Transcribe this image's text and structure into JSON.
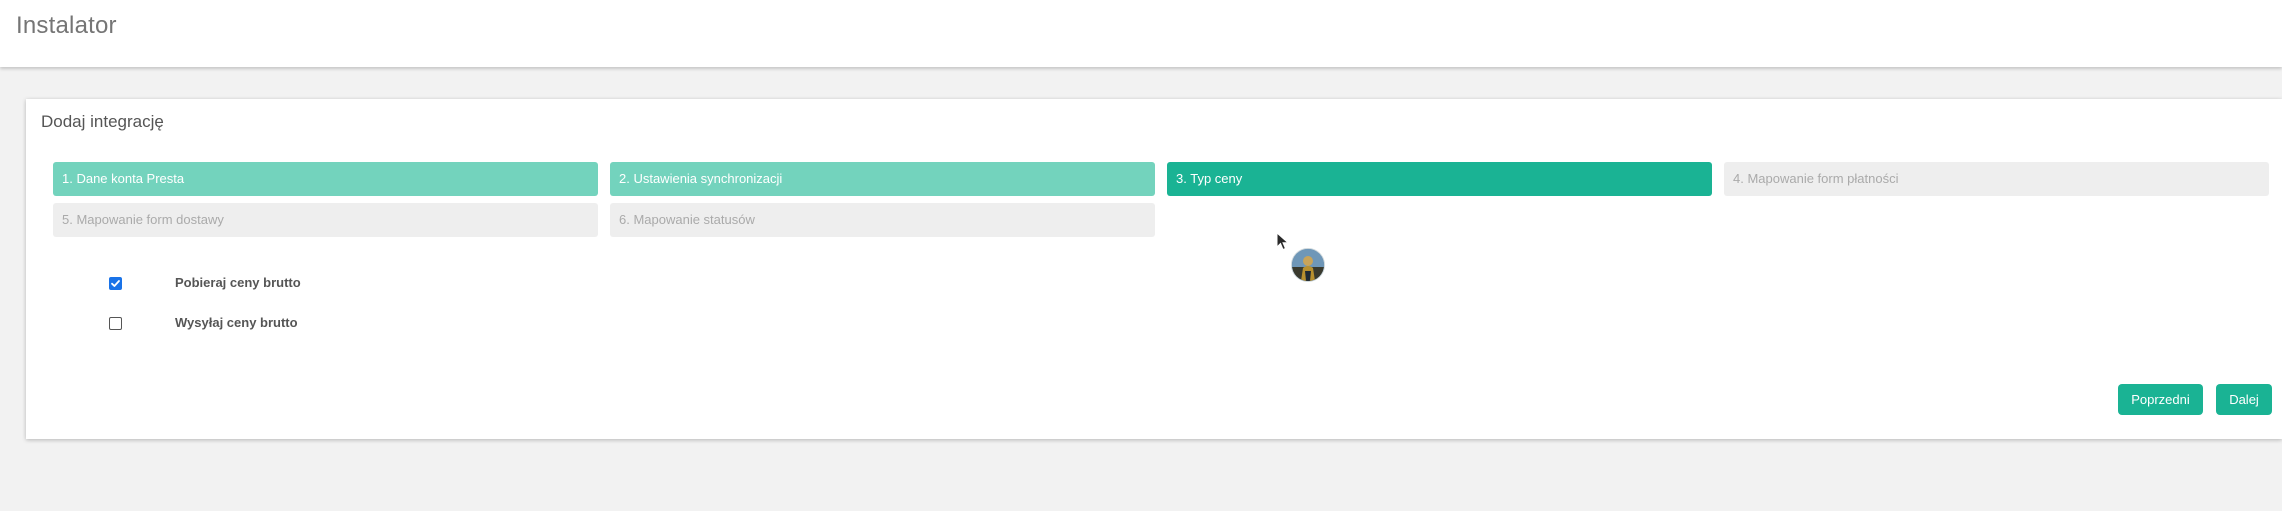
{
  "header": {
    "title": "Instalator"
  },
  "card": {
    "title": "Dodaj integrację"
  },
  "steps": [
    {
      "label": "1. Dane konta Presta",
      "state": "done"
    },
    {
      "label": "2. Ustawienia synchronizacji",
      "state": "done"
    },
    {
      "label": "3. Typ ceny",
      "state": "active"
    },
    {
      "label": "4. Mapowanie form płatności",
      "state": "pending"
    },
    {
      "label": "5. Mapowanie form dostawy",
      "state": "pending"
    },
    {
      "label": "6. Mapowanie statusów",
      "state": "pending"
    }
  ],
  "options": [
    {
      "label": "Pobieraj ceny brutto",
      "checked": true
    },
    {
      "label": "Wysyłaj ceny brutto",
      "checked": false
    }
  ],
  "buttons": {
    "previous": "Poprzedni",
    "next": "Dalej"
  },
  "colors": {
    "step_done": "#73d3bd",
    "step_active": "#1ab394",
    "step_pending": "#eeeeee",
    "checkbox_checked": "#1a73e8",
    "button": "#1ab394"
  },
  "icons": {
    "cursor": "mouse-pointer-icon",
    "avatar": "user-avatar"
  }
}
